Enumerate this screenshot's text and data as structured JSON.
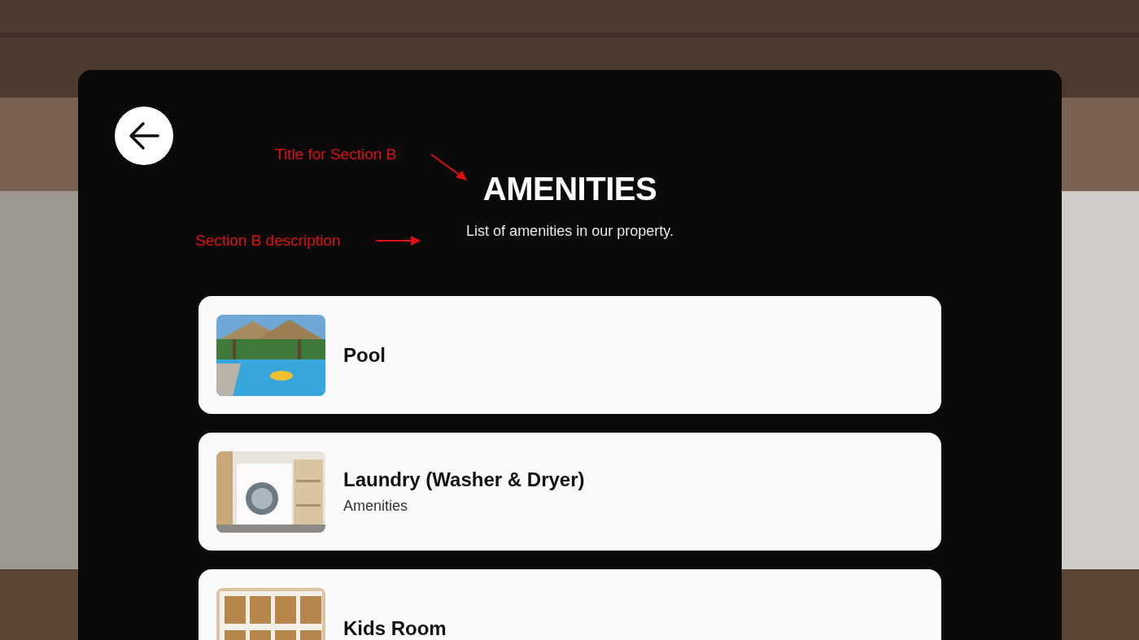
{
  "header": {
    "title": "AMENITIES",
    "description": "List of amenities in our property."
  },
  "annotations": [
    {
      "text": "Title for Section B"
    },
    {
      "text": "Section B description"
    }
  ],
  "amenities": [
    {
      "title": "Pool"
    },
    {
      "title": "Laundry (Washer & Dryer)",
      "subtitle": "Amenities"
    },
    {
      "title": "Kids Room"
    }
  ]
}
